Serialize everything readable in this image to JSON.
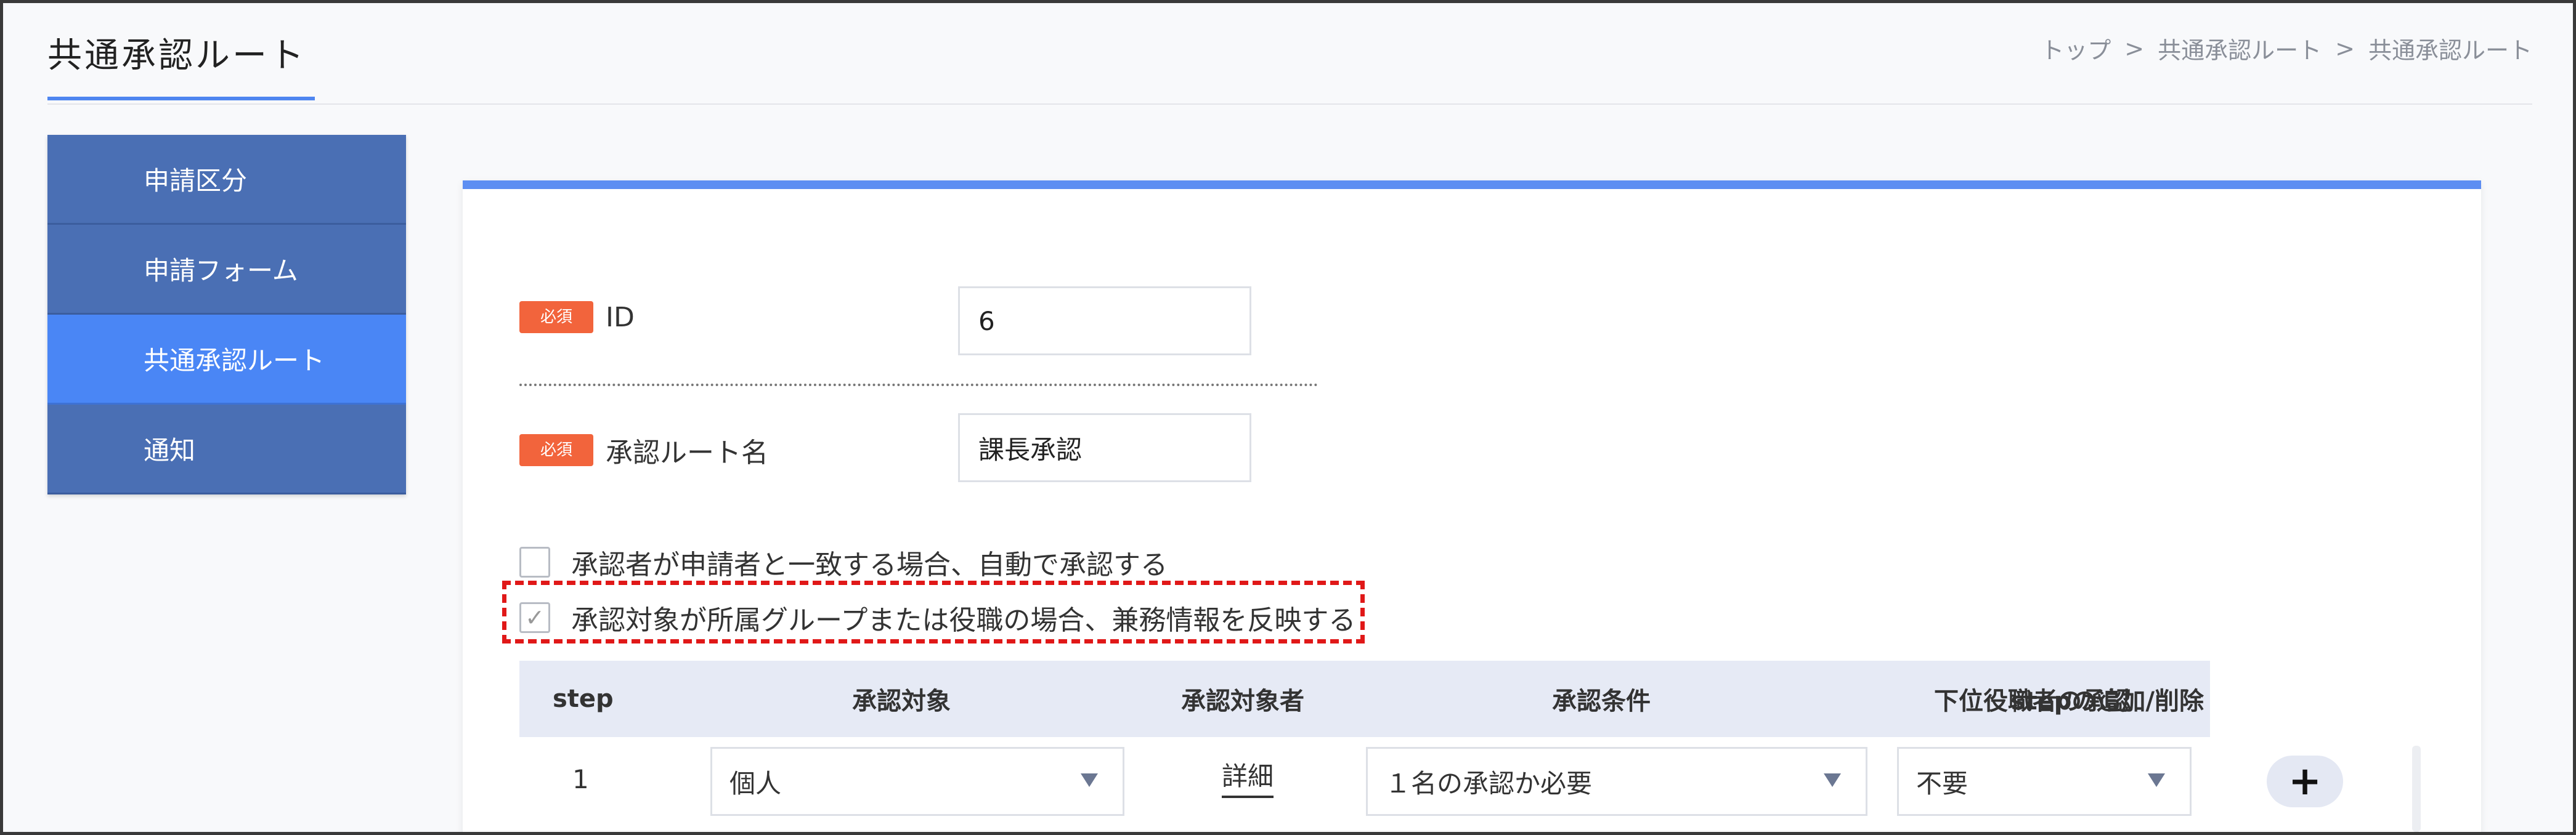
{
  "page": {
    "title": "共通承認ルート",
    "breadcrumb": [
      "トップ",
      "共通承認ルート",
      "共通承認ルート"
    ],
    "breadcrumb_separator": ">"
  },
  "sidebar": {
    "items": [
      {
        "label": "申請区分",
        "active": false
      },
      {
        "label": "申請フォーム",
        "active": false
      },
      {
        "label": "共通承認ルート",
        "active": true
      },
      {
        "label": "通知",
        "active": false
      }
    ]
  },
  "form": {
    "required_badge": "必須",
    "id_label": "ID",
    "id_value": "6",
    "route_name_label": "承認ルート名",
    "route_name_value": "課長承認",
    "checkbox_auto_approve": {
      "label": "承認者が申請者と一致する場合、自動で承認する",
      "checked": false
    },
    "checkbox_concurrent": {
      "label": "承認対象が所属グループまたは役職の場合、兼務情報を反映する",
      "checked": true
    }
  },
  "table": {
    "headers": [
      "step",
      "承認対象",
      "承認対象者",
      "承認条件",
      "下位役職者の承認",
      "stepの追加/削除"
    ],
    "rows": [
      {
        "step": "1",
        "target": "個人",
        "approver_link": "詳細",
        "condition": "１名の承認か必要",
        "subordinate_approval": "不要",
        "add_button": "+"
      }
    ]
  },
  "colors": {
    "accent": "#4f86f0",
    "sidebar": "#4a6fb4",
    "sidebar_active": "#4a86f5",
    "required_badge": "#f2643c",
    "highlight": "#e01818"
  }
}
